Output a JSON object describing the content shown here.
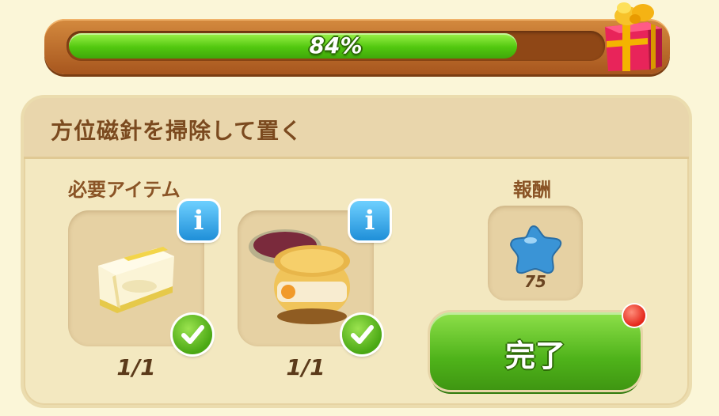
{
  "progress": {
    "percent_label": "84%",
    "fraction": 0.84
  },
  "task": {
    "title": "方位磁針を掃除して置く",
    "required_label": "必要アイテム",
    "reward_label": "報酬",
    "items": [
      {
        "icon": "cloth-rag-icon",
        "count": "1/1",
        "info": "i"
      },
      {
        "icon": "polish-jar-icon",
        "count": "1/1",
        "info": "i"
      }
    ],
    "reward": {
      "icon": "blue-star-icon",
      "amount": "75"
    },
    "complete_label": "完了"
  },
  "colors": {
    "progress_fill": "#52c80f",
    "frame": "#c0702e",
    "complete_button": "#4fb31a",
    "info_button": "#1f8fd8",
    "reward_star": "#3a94d6"
  }
}
